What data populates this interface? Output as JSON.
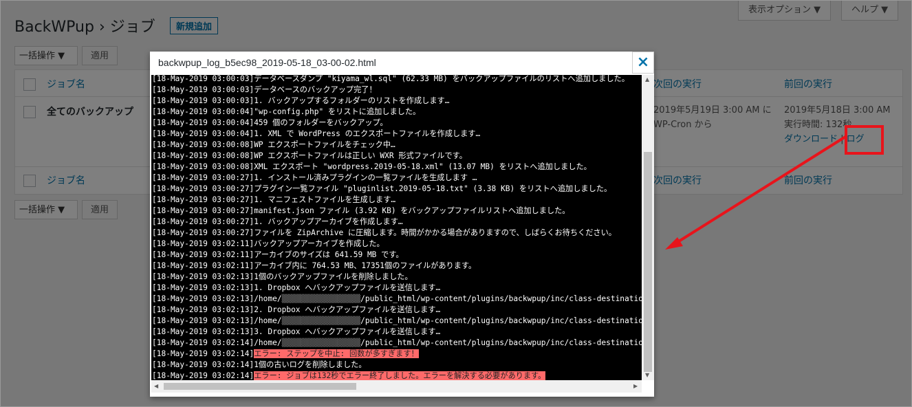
{
  "header": {
    "title": "BackWPup › ジョブ",
    "add_new": "新規追加",
    "screen_options": "表示オプション ▼",
    "help": "ヘルプ ▼"
  },
  "bulk": {
    "label": "一括操作 ▼",
    "apply": "適用"
  },
  "table": {
    "col_job": "ジョブ名",
    "col_next": "次回の実行",
    "col_last": "前回の実行",
    "row": {
      "name": "全てのバックアップ",
      "next_line1": "2019年5月19日 3:00 AM に",
      "next_line2": "WP-Cron から",
      "last_line1": "2019年5月18日 3:00 AM",
      "last_line2": "実行時間: 132秒",
      "download": "ダウンロード",
      "log": "ログ"
    }
  },
  "modal": {
    "title": "backwpup_log_b5ec98_2019-05-18_03-00-02.html",
    "close": "×",
    "lines": [
      {
        "ts": "[18-May-2019 03:00:03]",
        "msg": "データベースダンプ \"kiyama_wl.sql\" (62.33 MB) をバックアップファイルのリストへ追加しました。"
      },
      {
        "ts": "[18-May-2019 03:00:03]",
        "msg": "データベースのバックアップ完了！"
      },
      {
        "ts": "[18-May-2019 03:00:03]",
        "msg": "1. バックアップするフォルダーのリストを作成します…"
      },
      {
        "ts": "[18-May-2019 03:00:04]",
        "msg": "\"wp-config.php\" をリストに追加しました。"
      },
      {
        "ts": "[18-May-2019 03:00:04]",
        "msg": "459 個のフォルダーをバックアップ。"
      },
      {
        "ts": "[18-May-2019 03:00:04]",
        "msg": "1. XML で WordPress のエクスポートファイルを作成します…"
      },
      {
        "ts": "[18-May-2019 03:00:08]",
        "msg": "WP エクスポートファイルをチェック中…"
      },
      {
        "ts": "[18-May-2019 03:00:08]",
        "msg": "WP エクスポートファイルは正しい WXR 形式ファイルです。"
      },
      {
        "ts": "[18-May-2019 03:00:08]",
        "msg": "XML エクスポート \"wordpress.2019-05-18.xml\" (13.07 MB) をリストへ追加しました。"
      },
      {
        "ts": "[18-May-2019 03:00:27]",
        "msg": "1. インストール済みプラグインの一覧ファイルを生成します …"
      },
      {
        "ts": "[18-May-2019 03:00:27]",
        "msg": "プラグイン一覧ファイル \"pluginlist.2019-05-18.txt\" (3.38 KB) をリストへ追加しました。"
      },
      {
        "ts": "[18-May-2019 03:00:27]",
        "msg": "1. マニフェストファイルを生成します…"
      },
      {
        "ts": "[18-May-2019 03:00:27]",
        "msg": "manifest.json ファイル (3.92 KB) をバックアップファイルリストへ追加しました。"
      },
      {
        "ts": "[18-May-2019 03:00:27]",
        "msg": "1. バックアップアーカイブを作成します…"
      },
      {
        "ts": "[18-May-2019 03:00:27]",
        "msg": "ファイルを ZipArchive に圧縮します。時間がかかる場合がありますので、しばらくお待ちください。"
      },
      {
        "ts": "[18-May-2019 03:02:11]",
        "msg": "バックアップアーカイブを作成した。"
      },
      {
        "ts": "[18-May-2019 03:02:11]",
        "msg": "アーカイブのサイズは 641.59 MB です。"
      },
      {
        "ts": "[18-May-2019 03:02:11]",
        "msg": "アーカイブ内に 764.53 MB、17351個のファイルがあります。"
      },
      {
        "ts": "[18-May-2019 03:02:13]",
        "msg": "1個のバックアップファイルを削除しました。"
      },
      {
        "ts": "[18-May-2019 03:02:13]",
        "msg": "1. Dropbox へバックアップファイルを送信します…"
      },
      {
        "ts": "[18-May-2019 03:02:13]",
        "msg": "/home/",
        "masked": "▒▒▒▒▒▒▒▒▒▒▒▒▒▒▒▒▒",
        "tail": "/public_html/wp-content/plugins/backwpup/inc/class-destination-dropbox.php"
      },
      {
        "ts": "[18-May-2019 03:02:13]",
        "msg": "2. Dropbox へバックアップファイルを送信します…"
      },
      {
        "ts": "[18-May-2019 03:02:13]",
        "msg": "/home/",
        "masked": "▒▒▒▒▒▒▒▒▒▒▒▒▒▒▒▒▒",
        "tail": "/public_html/wp-content/plugins/backwpup/inc/class-destination-dropbox.php"
      },
      {
        "ts": "[18-May-2019 03:02:13]",
        "msg": "3. Dropbox へバックアップファイルを送信します…"
      },
      {
        "ts": "[18-May-2019 03:02:14]",
        "msg": "/home/",
        "masked": "▒▒▒▒▒▒▒▒▒▒▒▒▒▒▒▒▒",
        "tail": "/public_html/wp-content/plugins/backwpup/inc/class-destination-dropbox.php"
      },
      {
        "ts": "[18-May-2019 03:02:14]",
        "msg": "エラー: ステップを中止: 回数が多すぎます！",
        "error": true
      },
      {
        "ts": "[18-May-2019 03:02:14]",
        "msg": "1個の古いログを削除しました。"
      },
      {
        "ts": "[18-May-2019 03:02:14]",
        "msg": "エラー: ジョブは132秒でエラー終了しました。エラーを解決する必要があります。",
        "error": true
      }
    ]
  },
  "colors": {
    "accent": "#0073aa",
    "error_bg": "#ff6a6a",
    "annotation_red": "#e8141b"
  }
}
